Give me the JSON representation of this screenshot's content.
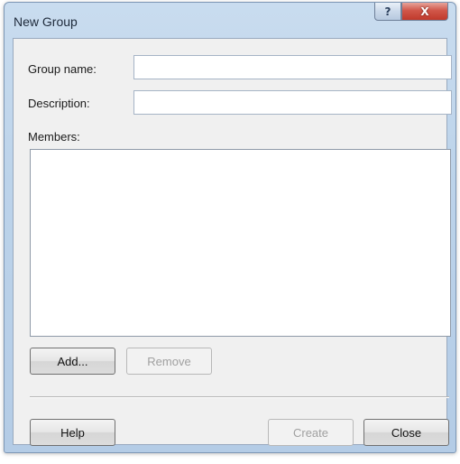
{
  "window": {
    "title": "New Group",
    "help_glyph": "?",
    "close_glyph": "X"
  },
  "form": {
    "group_name_label": "Group name:",
    "group_name_value": "",
    "description_label": "Description:",
    "description_value": "",
    "members_label": "Members:",
    "members": []
  },
  "buttons": {
    "add": "Add...",
    "remove": "Remove",
    "help": "Help",
    "create": "Create",
    "close": "Close"
  }
}
